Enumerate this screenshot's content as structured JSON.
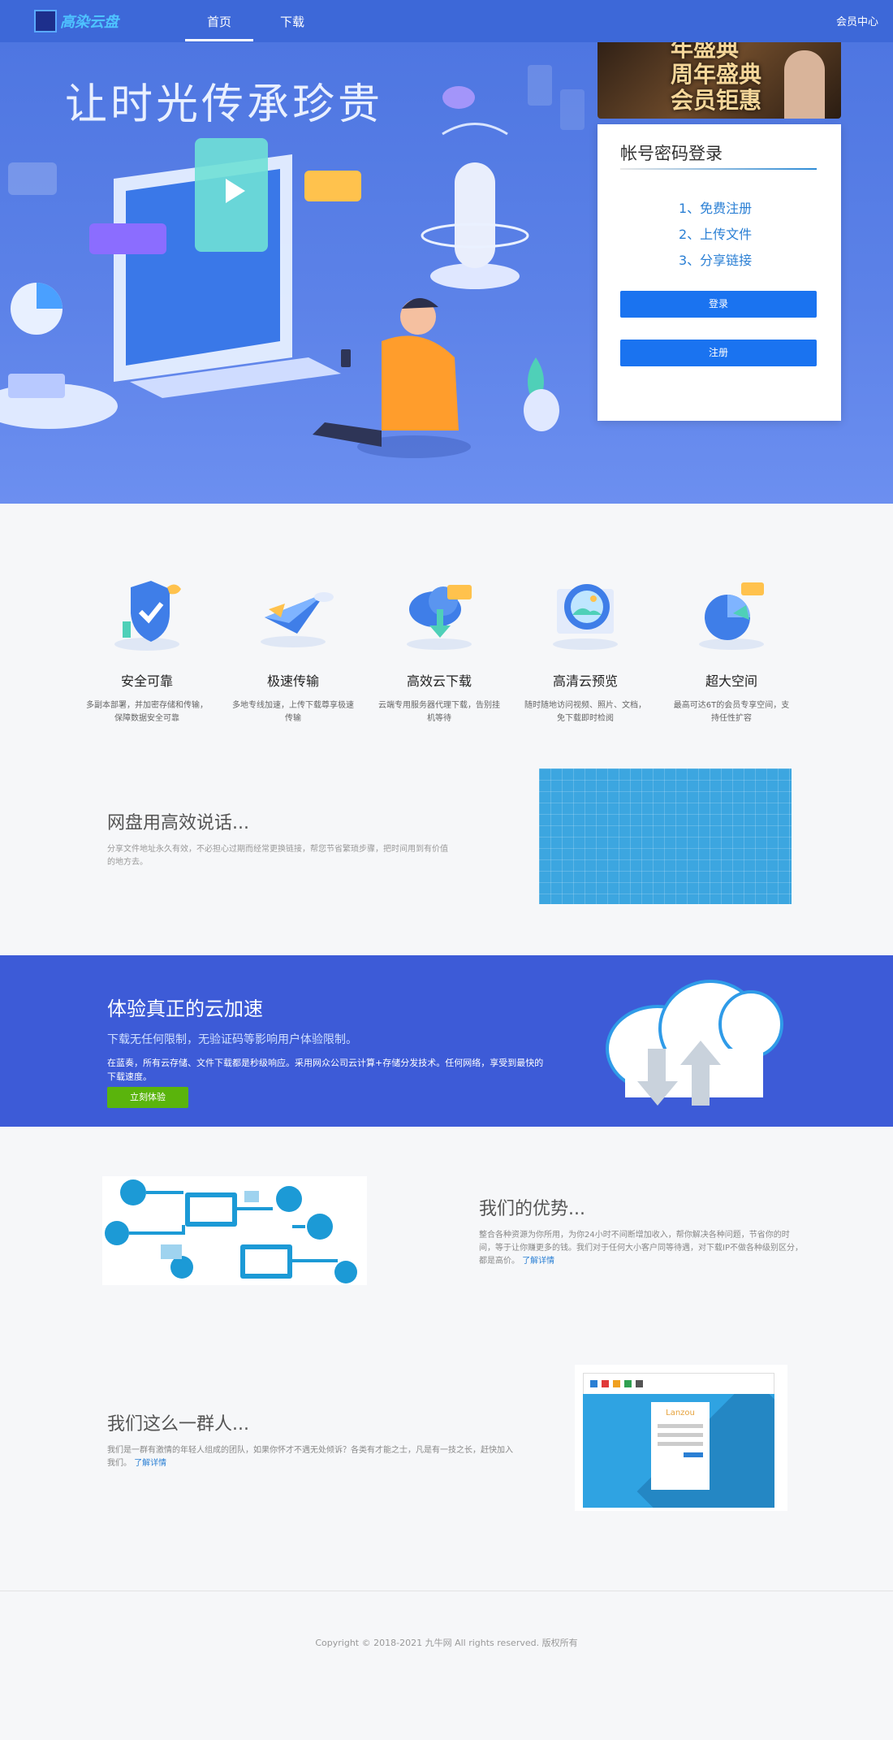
{
  "nav": {
    "logo": "高染云盘",
    "home": "首页",
    "download": "下载",
    "member": "会员中心"
  },
  "hero": {
    "title": "让时光传承珍贵"
  },
  "ad": {
    "line1": "年盛典",
    "line2": "周年盛典",
    "line3": "会员钜惠"
  },
  "login": {
    "title": "帐号密码登录",
    "steps": [
      "1、免费注册",
      "2、上传文件",
      "3、分享链接"
    ],
    "login_btn": "登录",
    "register_btn": "注册"
  },
  "features": [
    {
      "title": "安全可靠",
      "desc": "多副本部署，并加密存储和传输，保障数据安全可靠",
      "icon": "shield-icon"
    },
    {
      "title": "极速传输",
      "desc": "多地专线加速，上传下载尊享极速传输",
      "icon": "paper-plane-icon"
    },
    {
      "title": "高效云下载",
      "desc": "云端专用服务器代理下载，告别挂机等待",
      "icon": "cloud-download-icon"
    },
    {
      "title": "高清云预览",
      "desc": "随时随地访问视频、照片、文档，免下载即时检阅",
      "icon": "image-preview-icon"
    },
    {
      "title": "超大空间",
      "desc": "最高可达6T的会员专享空间，支持任性扩容",
      "icon": "pie-chart-icon"
    }
  ],
  "talk": {
    "title": "网盘用高效说话...",
    "desc": "分享文件地址永久有效，不必担心过期而经常更换链接，帮您节省繁琐步骤，把时间用到有价值的地方去。"
  },
  "band": {
    "title": "体验真正的云加速",
    "subtitle": "下载无任何限制，无验证码等影响用户体验限制。",
    "desc": "在蓝奏，所有云存储、文件下载都是秒级响应。采用网众公司云计算+存储分发技术。任何网络，享受到最快的下载速度。",
    "button": "立刻体验"
  },
  "advantage": {
    "title": "我们的优势...",
    "desc": "整合各种资源为你所用，为你24小时不间断增加收入，帮你解决各种问题，节省你的时间，等于让你赚更多的钱。我们对于任何大小客户同等待遇，对下载IP不做各种级别区分，都是高价。",
    "link": "了解详情"
  },
  "team": {
    "title": "我们这么一群人...",
    "desc": "我们是一群有激情的年轻人组成的团队，如果你怀才不遇无处倾诉？各类有才能之士，凡是有一技之长，赶快加入我们。",
    "link": "了解详情",
    "mock_brand": "Lanzou"
  },
  "footer": {
    "copyright": "Copyright © 2018-2021 九牛网 All rights reserved. 版权所有"
  },
  "colors": {
    "nav": "#3d68d8",
    "band": "#3d5bd7",
    "button": "#1a73f0",
    "cta": "#5ab40c"
  }
}
